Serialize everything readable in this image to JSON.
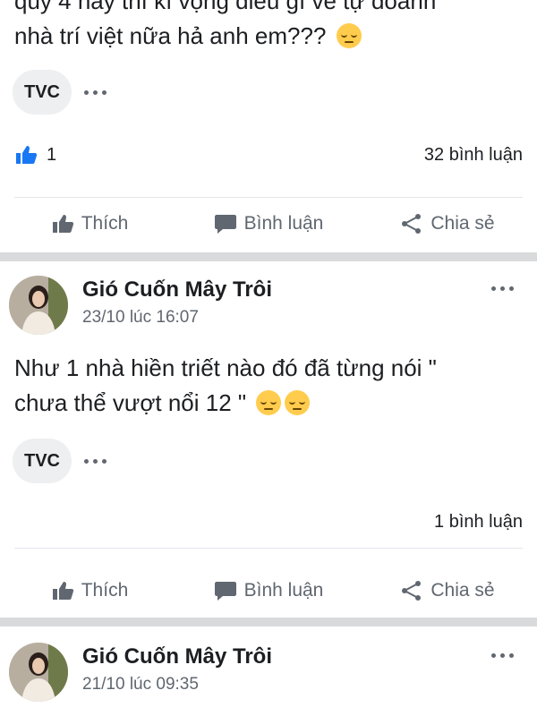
{
  "post1": {
    "text_line1": "quý 4 này thì kì vọng điều gì về tự doanh",
    "text_line2": "nhà trí việt nữa hả anh em???",
    "chip": "TVC",
    "like_count": "1",
    "comment_count": "32 bình luận"
  },
  "post2": {
    "author": "Gió Cuốn Mây Trôi",
    "time": "23/10 lúc 16:07",
    "text_line1": "Như 1 nhà hiền triết nào đó đã từng nói \"",
    "text_line2": "chưa thể vượt nổi 12 \"",
    "chip": "TVC",
    "comment_count": "1 bình luận"
  },
  "post3": {
    "author": "Gió Cuốn Mây Trôi",
    "time": "21/10 lúc 09:35"
  },
  "actions": {
    "like": "Thích",
    "comment": "Bình luận",
    "share": "Chia sẻ"
  },
  "icons": {
    "like": "thumbs-up-icon",
    "comment": "speech-bubble-icon",
    "share": "share-icon",
    "more": "more-horizontal-icon"
  },
  "colors": {
    "like_blue": "#1877f2",
    "muted": "#606770",
    "separator": "#d9dadc"
  }
}
